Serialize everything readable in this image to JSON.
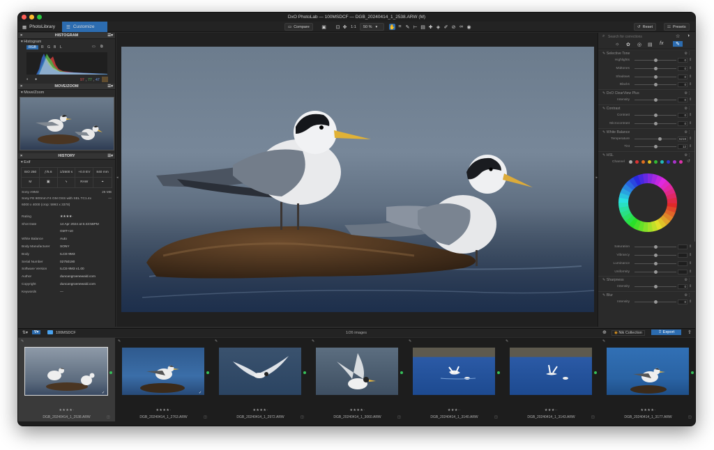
{
  "window": {
    "title": "DxO PhotoLab — 100MSDCF — DGB_20240414_1_2538.ARW (M)"
  },
  "toolbar": {
    "tab_library": "PhotoLibrary",
    "tab_customize": "Customize",
    "compare": "Compare",
    "zoom_1to1": "1:1",
    "zoom_pct": "50 %",
    "reset": "Reset",
    "presets": "Presets"
  },
  "histogram": {
    "title": "HISTOGRAM",
    "sub": "Histogram",
    "channels": [
      "RGB",
      "R",
      "G",
      "B",
      "L"
    ],
    "rgb_readout_r": "97",
    "rgb_readout_g": "77",
    "rgb_readout_b": "47"
  },
  "movezoom": {
    "title": "MOVE/ZOOM",
    "sub": "Move/Zoom"
  },
  "history": {
    "title": "HISTORY",
    "sub": "Exif"
  },
  "exif": {
    "iso": "ISO 250",
    "fstop": "ƒ/5.6",
    "shutter": "1/2500 s",
    "ev": "+0.0 EV",
    "focal": "840 mm",
    "mode_m": "M",
    "mode_raw": "RAW"
  },
  "camera": {
    "body": "Sony A9M3",
    "size": "26 MB",
    "lens": "Sony FE 600mm F4 GM OSS with SEL TC1.4x",
    "lens_dash": "—",
    "dims": "6000 x 4000 (crop: 5993 x 3378)"
  },
  "meta": [
    {
      "k": "Rating",
      "v": "★★★★·"
    },
    {
      "k": "Shot Date",
      "v": "14 Apr 2024 at 5:43:56PM"
    },
    {
      "k": "",
      "v": "GMT+10"
    },
    {
      "k": "White Balance",
      "v": "Auto"
    },
    {
      "k": "Body Manufacturer",
      "v": "SONY"
    },
    {
      "k": "Body",
      "v": "ILCE-9M3"
    },
    {
      "k": "Serial Number",
      "v": "02750190"
    },
    {
      "k": "Software Version",
      "v": "ILCE-9M3 v1.00"
    },
    {
      "k": "Author",
      "v": "duncangroenewald.com"
    },
    {
      "k": "Copyright",
      "v": "duncangroenewald.com"
    },
    {
      "k": "Keywords",
      "v": "—"
    }
  ],
  "right": {
    "search_placeholder": "Search for corrections",
    "selective_tone": {
      "title": "Selective Tone",
      "rows": [
        {
          "label": "Highlights",
          "value": "0"
        },
        {
          "label": "Midtones",
          "value": "0"
        },
        {
          "label": "Shadows",
          "value": "0"
        },
        {
          "label": "Blacks",
          "value": "0"
        }
      ]
    },
    "clearview": {
      "title": "DxO ClearView Plus",
      "rows": [
        {
          "label": "Intensity",
          "value": "0"
        }
      ]
    },
    "contrast": {
      "title": "Contrast",
      "rows": [
        {
          "label": "Contrast",
          "value": "0"
        },
        {
          "label": "Microcontrast",
          "value": "0"
        }
      ]
    },
    "whitebalance": {
      "title": "White Balance",
      "rows": [
        {
          "label": "Temperature",
          "value": "6219"
        },
        {
          "label": "Tint",
          "value": "12"
        }
      ]
    },
    "hsl": {
      "title": "HSL",
      "channel_label": "Channel",
      "rows": [
        {
          "label": "Saturation",
          "value": ""
        },
        {
          "label": "Vibrancy",
          "value": ""
        },
        {
          "label": "Luminance",
          "value": ""
        },
        {
          "label": "Uniformity",
          "value": ""
        }
      ]
    },
    "sharpness": {
      "title": "Sharpness",
      "rows": [
        {
          "label": "Intensity",
          "value": "0"
        }
      ]
    },
    "blur": {
      "title": "Blur",
      "rows": [
        {
          "label": "Intensity",
          "value": "0"
        }
      ]
    }
  },
  "filmstrip": {
    "folder": "100MSDCF",
    "count": "1/26 images",
    "nik": "Nik Collection",
    "export": "Export",
    "items": [
      {
        "name": "DGB_20240414_1_2538.ARW",
        "stars": "★★★★·"
      },
      {
        "name": "DGB_20240414_1_2763.ARW",
        "stars": "★★★★·"
      },
      {
        "name": "DGB_20240414_1_2972.ARW",
        "stars": "★★★★·"
      },
      {
        "name": "DGB_20240414_1_3060.ARW",
        "stars": "★★★★·"
      },
      {
        "name": "DGB_20240414_1_3140.ARW",
        "stars": "★★★··"
      },
      {
        "name": "DGB_20240414_1_3143.ARW",
        "stars": "★★★··"
      },
      {
        "name": "DGB_20240414_1_3177.ARW",
        "stars": "★★★★·"
      }
    ]
  }
}
